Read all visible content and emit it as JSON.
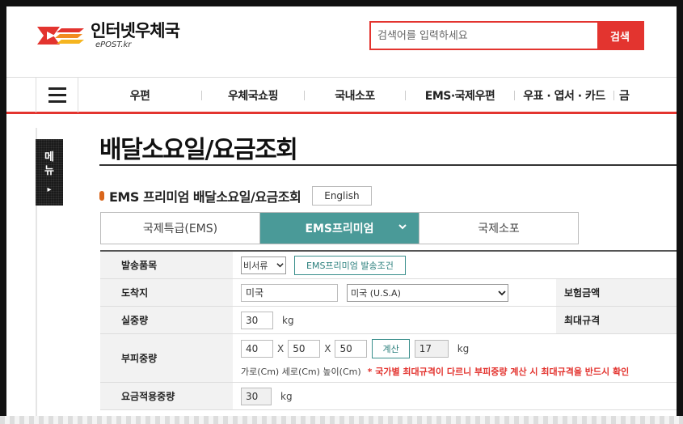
{
  "header": {
    "logo_title": "인터넷우체국",
    "logo_sub": "ePOST.kr",
    "search_placeholder": "검색어를 입력하세요",
    "search_button": "검색"
  },
  "nav": {
    "items": [
      "우편",
      "우체국쇼핑",
      "국내소포",
      "EMS·국제우편",
      "우표 · 엽서 · 카드",
      "금"
    ]
  },
  "side_menu": {
    "label_line1": "메",
    "label_line2": "뉴",
    "arrow": "▸"
  },
  "page": {
    "title": "배달소요일/요금조회",
    "subtitle": "EMS 프리미엄 배달소요일/요금조회",
    "english_button": "English"
  },
  "tabs": [
    {
      "label": "국제특급(EMS)",
      "active": false
    },
    {
      "label": "EMS프리미엄",
      "active": true
    },
    {
      "label": "국제소포",
      "active": false
    }
  ],
  "form": {
    "item_type": {
      "label": "발송품목",
      "value": "비서류",
      "conditions_button": "EMS프리미엄 발송조건"
    },
    "destination": {
      "label": "도착지",
      "country_text": "미국",
      "country_select": "미국 (U.S.A)",
      "insurance_label": "보험금액"
    },
    "actual_weight": {
      "label": "실중량",
      "value": "30",
      "unit": "kg",
      "max_label": "최대규격"
    },
    "volume_weight": {
      "label": "부피중량",
      "width": "40",
      "depth": "50",
      "height": "50",
      "times": "X",
      "calc_button": "계산",
      "result": "17",
      "unit": "kg",
      "dims_note": "가로(Cm) 세로(Cm) 높이(Cm)",
      "warning": "* 국가별 최대규격이 다르니 부피중량 계산 시 최대규격을 반드시 확인"
    },
    "applied_weight": {
      "label": "요금적용중량",
      "value": "30",
      "unit": "kg"
    }
  },
  "colors": {
    "brand_red": "#e3342f",
    "tab_active": "#4a9a98",
    "bullet": "#d9661c"
  }
}
